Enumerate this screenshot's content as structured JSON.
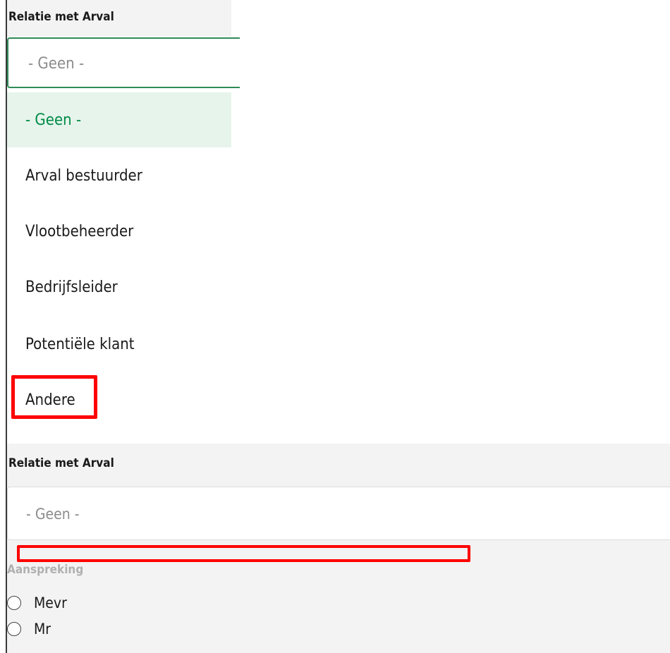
{
  "top": {
    "label": "Relatie met Arval",
    "select_value": "- Geen -",
    "options": [
      {
        "label": "- Geen -",
        "selected": true
      },
      {
        "label": "Arval bestuurder",
        "selected": false
      },
      {
        "label": "Vlootbeheerder",
        "selected": false
      },
      {
        "label": "Bedrijfsleider",
        "selected": false
      },
      {
        "label": "Potentiële klant",
        "selected": false
      },
      {
        "label": "Andere",
        "selected": false
      }
    ]
  },
  "bottom": {
    "label": "Relatie met Arval",
    "select_value": "- Geen -",
    "salutation_label": "Aanspreking",
    "radios": [
      {
        "label": "Mevr"
      },
      {
        "label": "Mr"
      }
    ]
  },
  "colors": {
    "accent_green": "#2e8b57",
    "selected_text": "#008a45",
    "selected_bg": "#e6f4ec",
    "highlight": "#ff0000",
    "panel_bg": "#f3f3f3"
  }
}
